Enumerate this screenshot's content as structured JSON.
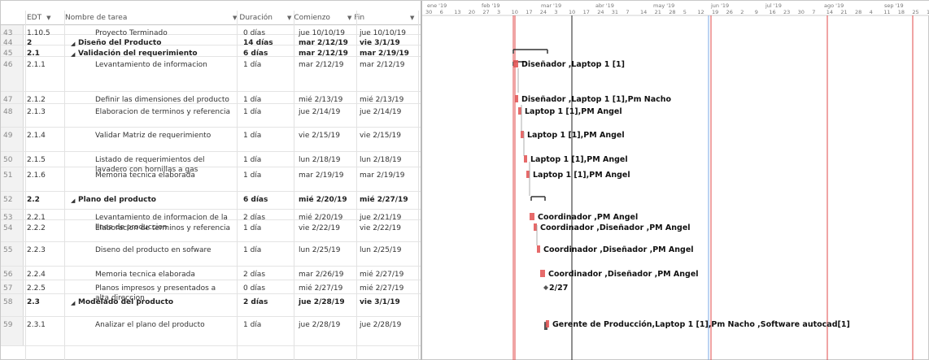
{
  "columns": {
    "edt": "EDT",
    "name": "Nombre de tarea",
    "duration": "Duración",
    "start": "Comienzo",
    "finish": "Fin"
  },
  "rows": [
    {
      "id": "43",
      "edt": "1.10.5",
      "name": "Proyecto Terminado",
      "dur": "0 días",
      "start": "jue 10/10/19",
      "finish": "jue 10/10/19",
      "bold": false,
      "summary": false,
      "indent": 2
    },
    {
      "id": "44",
      "edt": "2",
      "name": "Diseño del Producto",
      "dur": "14 días",
      "start": "mar 2/12/19",
      "finish": "vie 3/1/19",
      "bold": true,
      "summary": true,
      "indent": 0
    },
    {
      "id": "45",
      "edt": "2.1",
      "name": "Validación del requerimiento",
      "dur": "6 días",
      "start": "mar 2/12/19",
      "finish": "mar 2/19/19",
      "bold": true,
      "summary": true,
      "indent": 1
    },
    {
      "id": "46",
      "edt": "2.1.1",
      "name": "Levantamiento de informacion",
      "dur": "1 día",
      "start": "mar 2/12/19",
      "finish": "mar 2/12/19",
      "bold": false,
      "summary": false,
      "indent": 2
    },
    {
      "id": "47",
      "edt": "2.1.2",
      "name": "Definir las dimensiones del producto",
      "dur": "1 día",
      "start": "mié 2/13/19",
      "finish": "mié 2/13/19",
      "bold": false,
      "summary": false,
      "indent": 2
    },
    {
      "id": "48",
      "edt": "2.1.3",
      "name": "Elaboracion de terminos y referencia",
      "dur": "1 día",
      "start": "jue 2/14/19",
      "finish": "jue 2/14/19",
      "bold": false,
      "summary": false,
      "indent": 2
    },
    {
      "id": "49",
      "edt": "2.1.4",
      "name": "Validar Matriz de requerimiento",
      "dur": "1 día",
      "start": "vie 2/15/19",
      "finish": "vie 2/15/19",
      "bold": false,
      "summary": false,
      "indent": 2
    },
    {
      "id": "50",
      "edt": "2.1.5",
      "name": "Listado de requerimientos del lavadero con hornillas a gas",
      "dur": "1 día",
      "start": "lun 2/18/19",
      "finish": "lun 2/18/19",
      "bold": false,
      "summary": false,
      "indent": 2
    },
    {
      "id": "51",
      "edt": "2.1.6",
      "name": "Memoria tecnica elaborada",
      "dur": "1 día",
      "start": "mar 2/19/19",
      "finish": "mar 2/19/19",
      "bold": false,
      "summary": false,
      "indent": 2
    },
    {
      "id": "52",
      "edt": "2.2",
      "name": "Plano del producto",
      "dur": "6 días",
      "start": "mié 2/20/19",
      "finish": "mié 2/27/19",
      "bold": true,
      "summary": true,
      "indent": 1
    },
    {
      "id": "53",
      "edt": "2.2.1",
      "name": "Levantamiento de informacion de la linea de produccion",
      "dur": "2 días",
      "start": "mié 2/20/19",
      "finish": "jue 2/21/19",
      "bold": false,
      "summary": false,
      "indent": 2
    },
    {
      "id": "54",
      "edt": "2.2.2",
      "name": "Elaboracion de terminos y referencia",
      "dur": "1 día",
      "start": "vie 2/22/19",
      "finish": "vie 2/22/19",
      "bold": false,
      "summary": false,
      "indent": 2
    },
    {
      "id": "55",
      "edt": "2.2.3",
      "name": "Diseno del producto en sofware",
      "dur": "1 día",
      "start": "lun 2/25/19",
      "finish": "lun 2/25/19",
      "bold": false,
      "summary": false,
      "indent": 2
    },
    {
      "id": "56",
      "edt": "2.2.4",
      "name": "Memoria tecnica elaborada",
      "dur": "2 días",
      "start": "mar 2/26/19",
      "finish": "mié 2/27/19",
      "bold": false,
      "summary": false,
      "indent": 2
    },
    {
      "id": "57",
      "edt": "2.2.5",
      "name": "Planos impresos y presentados a alta direccion",
      "dur": "0 días",
      "start": "mié 2/27/19",
      "finish": "mié 2/27/19",
      "bold": false,
      "summary": false,
      "indent": 2
    },
    {
      "id": "58",
      "edt": "2.3",
      "name": "Modelado del producto",
      "dur": "2 días",
      "start": "jue 2/28/19",
      "finish": "vie 3/1/19",
      "bold": true,
      "summary": true,
      "indent": 1
    },
    {
      "id": "59",
      "edt": "2.3.1",
      "name": "Analizar el plano del producto",
      "dur": "1 día",
      "start": "jue 2/28/19",
      "finish": "jue 2/28/19",
      "bold": false,
      "summary": false,
      "indent": 2
    }
  ],
  "timescale": {
    "months": [
      "ene '19",
      "feb '19",
      "mar '19",
      "abr '19",
      "may '19",
      "jun '19",
      "jul '19",
      "ago '19",
      "sep '19"
    ],
    "days": [
      "30",
      "6",
      "13",
      "20",
      "27",
      "3",
      "10",
      "17",
      "24",
      "3",
      "10",
      "17",
      "24",
      "31",
      "7",
      "14",
      "21",
      "28",
      "5",
      "12",
      "19",
      "26",
      "2",
      "9",
      "16",
      "23",
      "30",
      "7",
      "14",
      "21",
      "28",
      "4",
      "11",
      "18",
      "25",
      "1"
    ]
  },
  "bar_labels": [
    {
      "row": 3,
      "text": "Diseñador ,Laptop 1 [1]"
    },
    {
      "row": 4,
      "text": "Diseñador ,Laptop 1 [1],Pm Nacho"
    },
    {
      "row": 5,
      "text": "Laptop 1 [1],PM Angel"
    },
    {
      "row": 6,
      "text": "Laptop 1 [1],PM Angel"
    },
    {
      "row": 7,
      "text": "Laptop 1 [1],PM Angel"
    },
    {
      "row": 8,
      "text": "Laptop 1 [1],PM Angel"
    },
    {
      "row": 10,
      "text": "Coordinador ,PM Angel"
    },
    {
      "row": 11,
      "text": "Coordinador ,Diseñador ,PM Angel"
    },
    {
      "row": 12,
      "text": "Coordinador ,Diseñador ,PM Angel"
    },
    {
      "row": 13,
      "text": "Coordinador ,Diseñador ,PM Angel"
    },
    {
      "row": 14,
      "text": "2/27"
    },
    {
      "row": 16,
      "text": "Gerente de Producción,Laptop 1 [1],Pm Nacho ,Software autocad[1]"
    }
  ],
  "colors": {
    "bar": "#e35a5a",
    "summary": "#333333",
    "redline": "#e14a4a",
    "blueline": "#7aa8e6",
    "darkline": "#222222",
    "grid_header": "#f3f3f3"
  }
}
